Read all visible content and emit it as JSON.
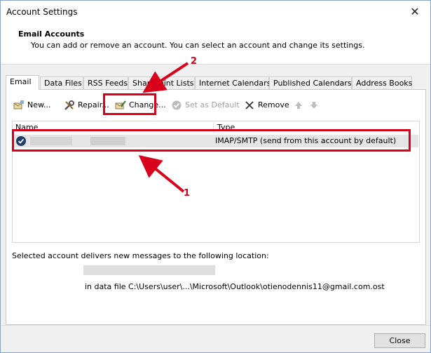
{
  "window": {
    "title": "Account Settings",
    "close_glyph": "✕"
  },
  "header": {
    "title": "Email Accounts",
    "subtitle": "You can add or remove an account. You can select an account and change its settings."
  },
  "tabs": [
    {
      "label": "Email",
      "active": true
    },
    {
      "label": "Data Files"
    },
    {
      "label": "RSS Feeds"
    },
    {
      "label": "SharePoint Lists"
    },
    {
      "label": "Internet Calendars"
    },
    {
      "label": "Published Calendars"
    },
    {
      "label": "Address Books"
    }
  ],
  "toolbar": {
    "new_label": "New...",
    "repair_label": "Repair...",
    "change_label": "Change...",
    "set_default_label": "Set as Default",
    "remove_label": "Remove"
  },
  "list": {
    "columns": {
      "name": "Name",
      "type": "Type"
    },
    "rows": [
      {
        "type": "IMAP/SMTP (send from this account by default)"
      }
    ]
  },
  "delivery": {
    "label": "Selected account delivers new messages to the following location:",
    "path": "in data file C:\\Users\\user\\...\\Microsoft\\Outlook\\otienodennis11@gmail.com.ost"
  },
  "footer": {
    "close_label": "Close"
  },
  "annotations": {
    "callout_1": "1",
    "callout_2": "2",
    "color": "#d9001b"
  }
}
